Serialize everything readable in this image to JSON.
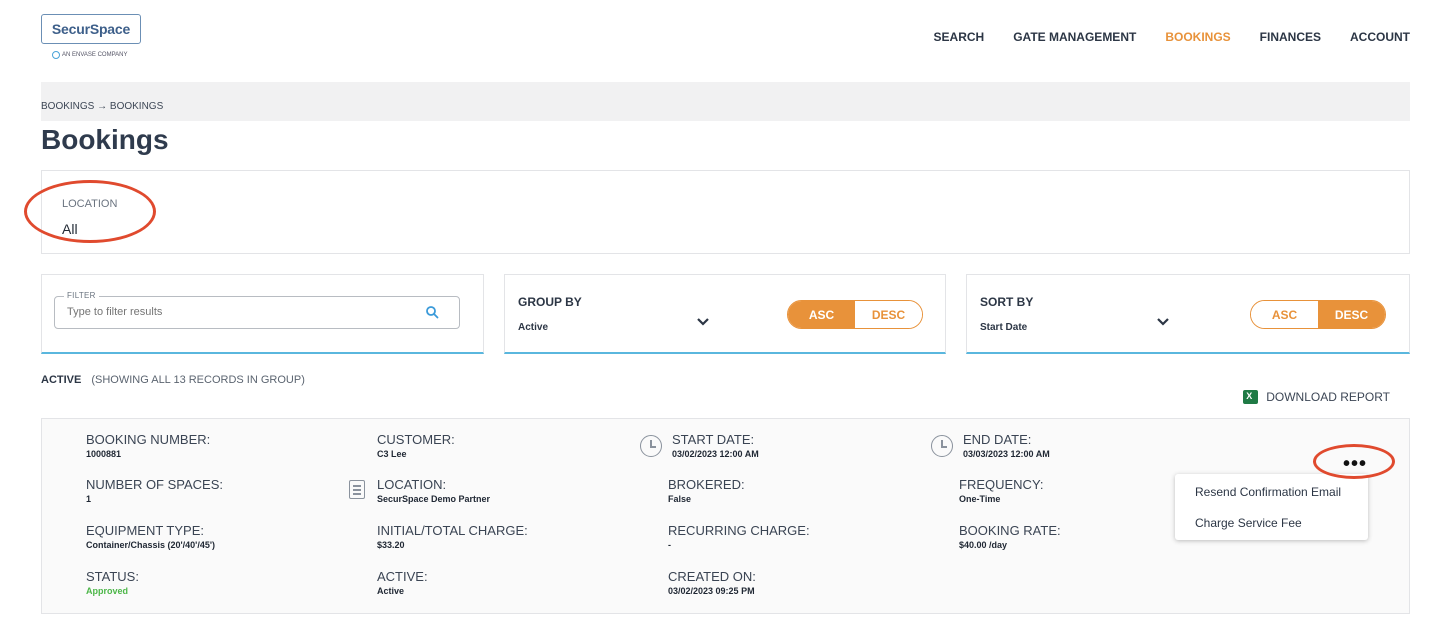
{
  "header": {
    "logo_text": "SecurSpace",
    "logo_tagline": "AN ENVASE COMPANY",
    "nav": [
      "SEARCH",
      "GATE MANAGEMENT",
      "BOOKINGS",
      "FINANCES",
      "ACCOUNT"
    ],
    "active_nav": "BOOKINGS"
  },
  "breadcrumb": "BOOKINGS → BOOKINGS",
  "page_title": "Bookings",
  "location": {
    "label": "LOCATION",
    "value": "All"
  },
  "filter": {
    "legend": "FILTER",
    "placeholder": "Type to filter results"
  },
  "group_by": {
    "label": "GROUP BY",
    "value": "Active",
    "asc": "ASC",
    "desc": "DESC",
    "selected": "ASC"
  },
  "sort_by": {
    "label": "SORT BY",
    "value": "Start Date",
    "asc": "ASC",
    "desc": "DESC",
    "selected": "DESC"
  },
  "group_header": {
    "name": "ACTIVE",
    "count_text": "(SHOWING ALL 13 RECORDS IN GROUP)"
  },
  "download_label": "DOWNLOAD REPORT",
  "booking": {
    "booking_number": {
      "label": "BOOKING NUMBER:",
      "value": "1000881"
    },
    "customer": {
      "label": "CUSTOMER:",
      "value": "C3 Lee"
    },
    "start_date": {
      "label": "START DATE:",
      "value": "03/02/2023 12:00 AM"
    },
    "end_date": {
      "label": "END DATE:",
      "value": "03/03/2023 12:00 AM"
    },
    "number_of_spaces": {
      "label": "NUMBER OF SPACES:",
      "value": "1"
    },
    "location": {
      "label": "LOCATION:",
      "value": "SecurSpace Demo Partner"
    },
    "brokered": {
      "label": "BROKERED:",
      "value": "False"
    },
    "frequency": {
      "label": "FREQUENCY:",
      "value": "One-Time"
    },
    "equipment_type": {
      "label": "EQUIPMENT TYPE:",
      "value": "Container/Chassis (20'/40'/45')"
    },
    "initial_total_charge": {
      "label": "INITIAL/TOTAL CHARGE:",
      "value": "$33.20"
    },
    "recurring_charge": {
      "label": "RECURRING CHARGE:",
      "value": "-"
    },
    "booking_rate": {
      "label": "BOOKING RATE:",
      "value": "$40.00 /day"
    },
    "status": {
      "label": "STATUS:",
      "value": "Approved"
    },
    "active": {
      "label": "ACTIVE:",
      "value": "Active"
    },
    "created_on": {
      "label": "CREATED ON:",
      "value": "03/02/2023 09:25 PM"
    }
  },
  "menu": {
    "more_label": "•••",
    "items": [
      "Resend Confirmation Email",
      "Charge Service Fee"
    ]
  },
  "colors": {
    "accent": "#e8923a",
    "annotation": "#e04a2e",
    "panel_underline": "#5ab7de",
    "status_approved": "#4cb648"
  }
}
